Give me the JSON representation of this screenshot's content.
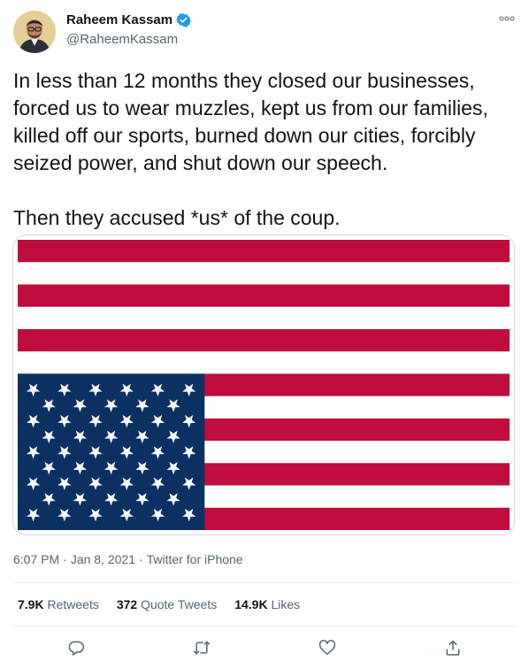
{
  "author": {
    "display_name": "Raheem Kassam",
    "handle": "@RaheemKassam",
    "verified_icon": "verified-badge-icon",
    "avatar": "avatar-photo"
  },
  "tweet": {
    "paragraph_1": "In less than 12 months they closed our businesses, forced us to wear muzzles, kept us from our families, killed off our sports, burned down our cities, forcibly seized power, and shut down our speech.",
    "paragraph_2": "Then they accused *us* of the coup."
  },
  "media": {
    "description_icon": "upside-down-us-flag",
    "colors": {
      "stripe_red": "#bf0d3e",
      "canton_blue": "#0a3161",
      "white": "#ffffff"
    }
  },
  "meta": {
    "time": "6:07 PM",
    "separator_1": "·",
    "date": "Jan 8, 2021",
    "separator_2": "·",
    "source": "Twitter for iPhone"
  },
  "stats": {
    "retweets_count": "7.9K",
    "retweets_label": "Retweets",
    "quotes_count": "372",
    "quotes_label": "Quote Tweets",
    "likes_count": "14.9K",
    "likes_label": "Likes"
  },
  "actions": [
    "reply-icon",
    "retweet-icon",
    "like-icon",
    "share-icon"
  ],
  "colors": {
    "text_primary": "#0f1419",
    "text_secondary": "#536471",
    "verified_blue": "#1d9bf0",
    "border": "#cfd9de"
  }
}
